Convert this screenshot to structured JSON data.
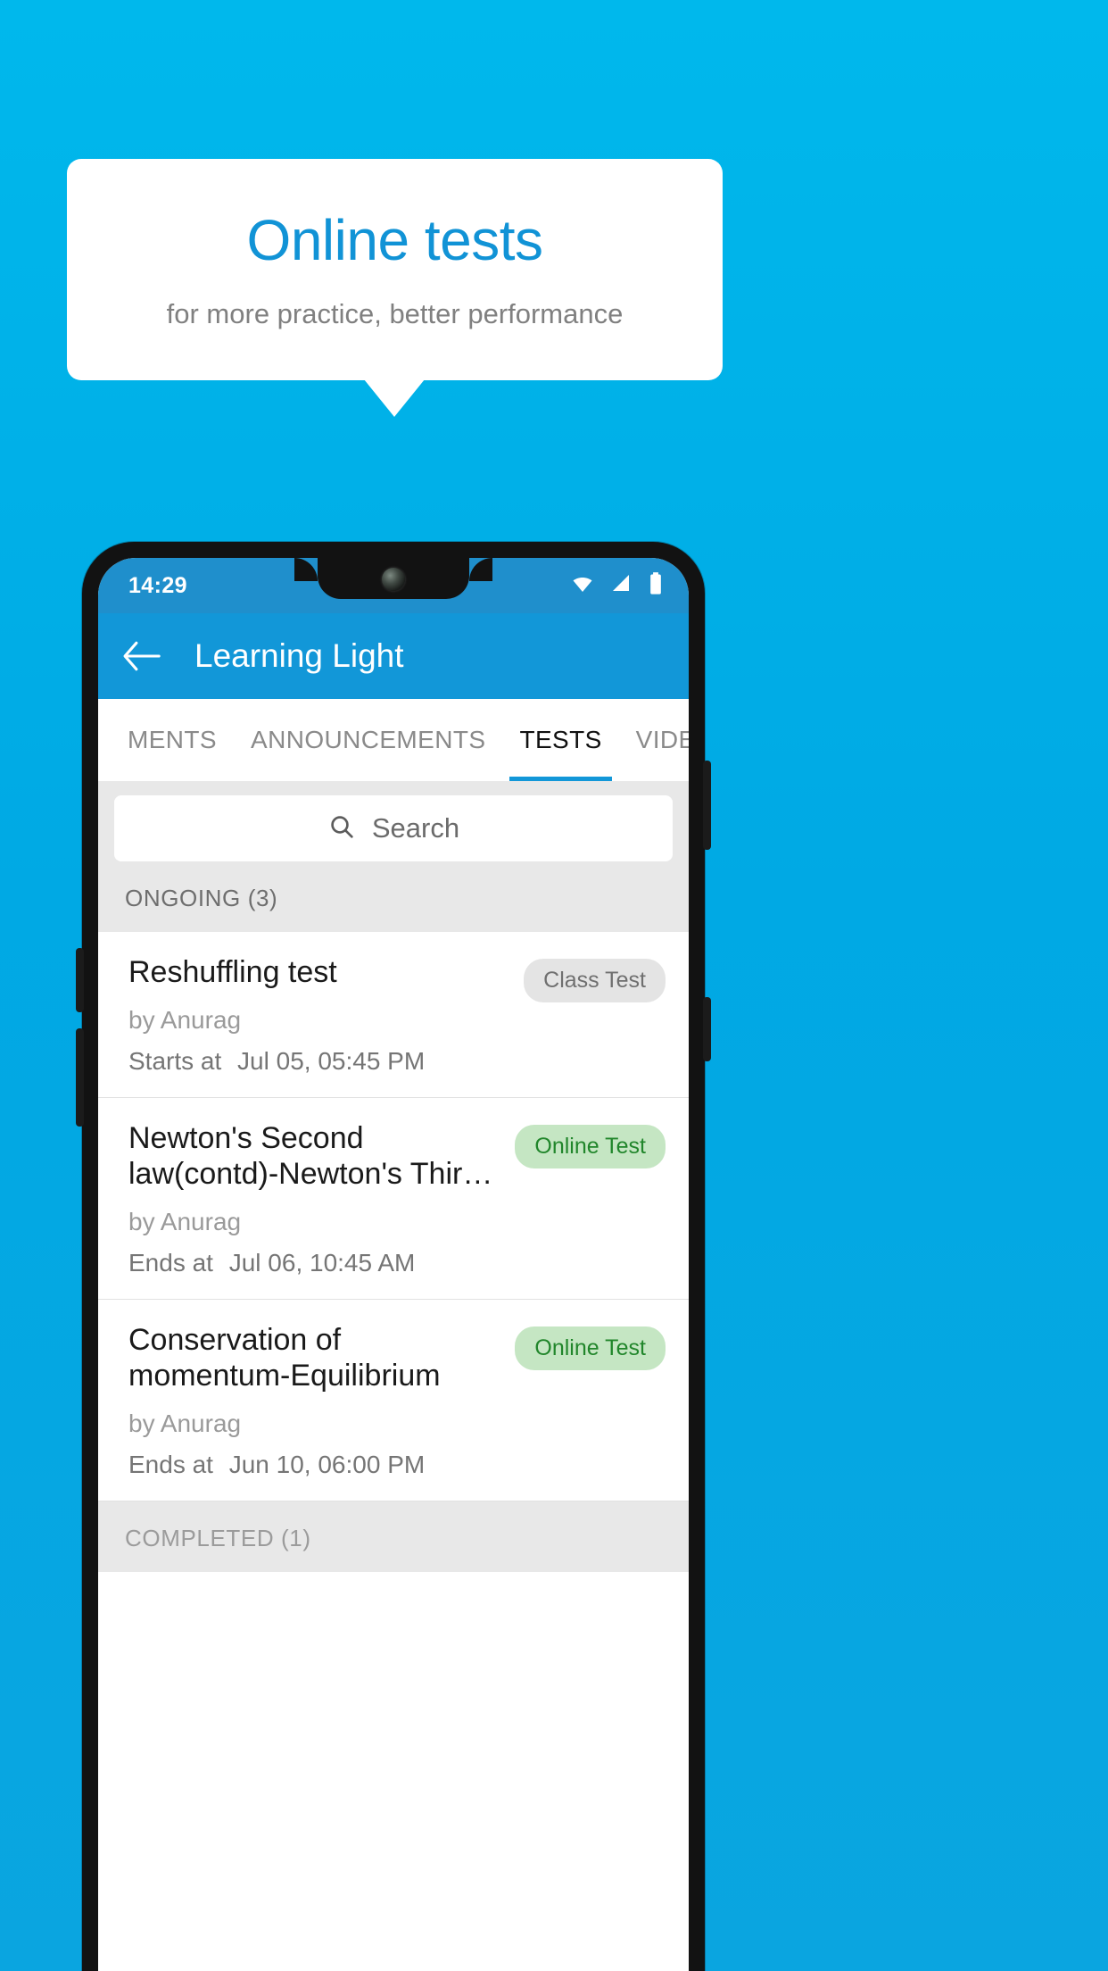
{
  "promo": {
    "title": "Online tests",
    "subtitle": "for more practice, better performance"
  },
  "phone": {
    "status_bar": {
      "time": "14:29",
      "icons": [
        "wifi-icon",
        "signal-icon",
        "battery-icon"
      ]
    },
    "appbar": {
      "back_icon": "back-arrow-icon",
      "title": "Learning Light"
    },
    "tabs": [
      {
        "label": "MENTS",
        "active": false
      },
      {
        "label": "ANNOUNCEMENTS",
        "active": false
      },
      {
        "label": "TESTS",
        "active": true
      },
      {
        "label": "VIDEOS",
        "active": false
      }
    ],
    "search": {
      "icon": "search-icon",
      "placeholder": "Search",
      "value": ""
    },
    "sections": [
      {
        "header": "ONGOING (3)",
        "items": [
          {
            "title": "Reshuffling test",
            "author": "by Anurag",
            "time_label": "Starts at",
            "time_value": "Jul 05, 05:45 PM",
            "badge": "Class Test",
            "badge_type": "class"
          },
          {
            "title": "Newton's Second law(contd)-Newton's Thir…",
            "author": "by Anurag",
            "time_label": "Ends at",
            "time_value": "Jul 06, 10:45 AM",
            "badge": "Online Test",
            "badge_type": "online"
          },
          {
            "title": "Conservation of momentum-Equilibrium",
            "author": "by Anurag",
            "time_label": "Ends at",
            "time_value": "Jun 10, 06:00 PM",
            "badge": "Online Test",
            "badge_type": "online"
          }
        ]
      },
      {
        "header": "COMPLETED (1)",
        "items": []
      }
    ]
  },
  "colors": {
    "background_blue": "#00b8ec",
    "brand_blue": "#1297d8",
    "title_blue": "#1193d6",
    "badge_green_bg": "#c5e6c3",
    "badge_green_text": "#21862b",
    "badge_gray_bg": "#e4e4e4"
  }
}
